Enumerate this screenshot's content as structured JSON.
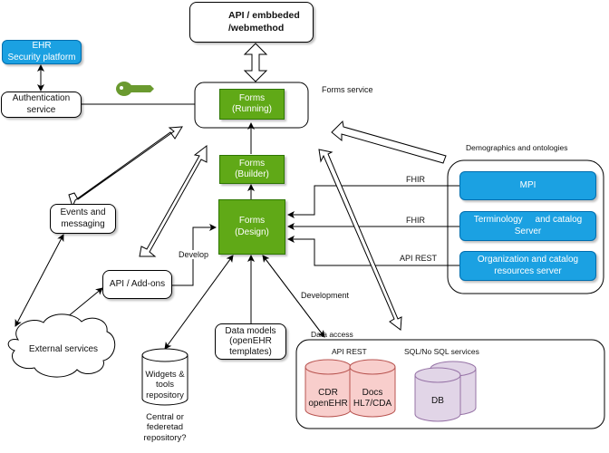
{
  "diagram": {
    "api_embedded": {
      "line1": "API / embbeded",
      "line2": "/webmethod",
      "icon": "gear-icon"
    },
    "ehr_security": {
      "line1": "EHR",
      "line2": "Security platform"
    },
    "authentication": {
      "line1": "Authentication",
      "line2": "service"
    },
    "key_icon": "key-icon",
    "forms_service_label": "Forms service",
    "forms_running": {
      "line1": "Forms",
      "line2": "(Running)"
    },
    "forms_builder": {
      "line1": "Forms",
      "line2": "(Builder)"
    },
    "forms_design": {
      "line1": "Forms",
      "line2": "(Design)"
    },
    "events": {
      "line1": "Events and",
      "line2": "messaging"
    },
    "api_addons": {
      "label": "API / Add-ons"
    },
    "external_services": {
      "label": "External services"
    },
    "widgets_repo": {
      "line1": "Widgets &",
      "line2": "tools",
      "line3": "repository"
    },
    "widgets_caption": {
      "line1": "Central or",
      "line2": "federetad",
      "line3": "repository?"
    },
    "data_models": {
      "line1": "Data models",
      "line2": "(openEHR",
      "line3": "templates)"
    },
    "demographics": {
      "title": "Demographics and ontologies",
      "mpi": "MPI",
      "terminology": {
        "line1": "Terminology     and catalog",
        "line2": "Server"
      },
      "organization": {
        "line1": "Organization and catalog",
        "line2": "resources server"
      }
    },
    "edge_labels": {
      "fhir_1": "FHIR",
      "fhir_2": "FHIR",
      "api_rest": "API REST",
      "develop": "Develop",
      "development": "Development"
    },
    "data_access": {
      "title": "Data access",
      "api_rest_label": "API REST",
      "sql_label": "SQL/No SQL services",
      "cdr": {
        "line1": "CDR",
        "line2": "openEHR"
      },
      "docs": {
        "line1": "Docs",
        "line2": "HL7/CDA"
      },
      "db": "DB"
    },
    "colors": {
      "green": "#60a917",
      "blue": "#1ba1e2",
      "pink": "#f8cecc",
      "purple": "#e1d5e7",
      "key_green": "#6a9a2f",
      "gear_orange": "#f5b82e"
    }
  }
}
